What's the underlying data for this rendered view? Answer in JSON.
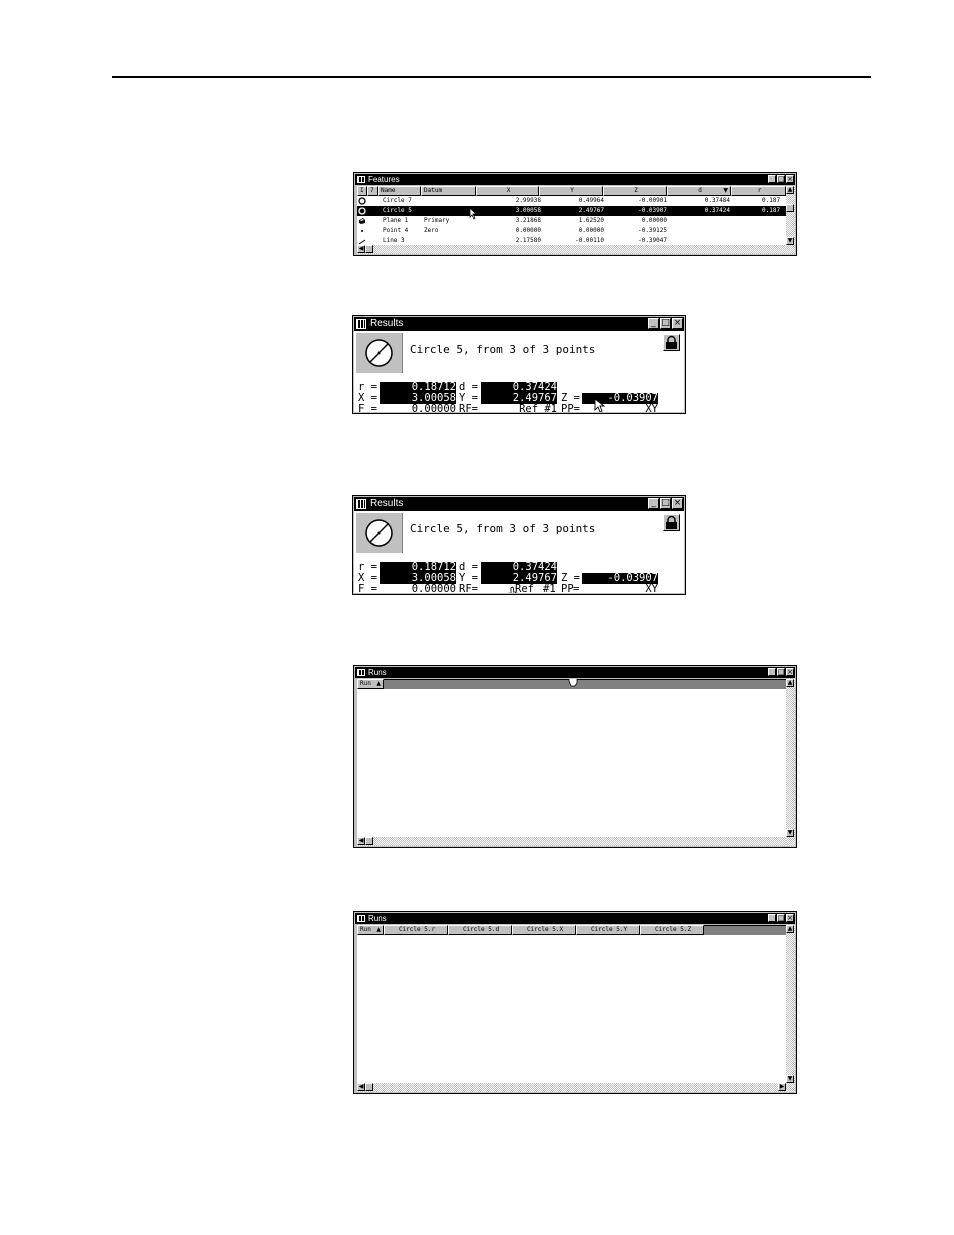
{
  "features": {
    "title": "Features",
    "headers": [
      "I",
      "7",
      "Name",
      "Datum",
      "X",
      "Y",
      "Z",
      "d",
      "r"
    ],
    "rows": [
      {
        "icon": "circle-icon",
        "name": "Circle 7",
        "datum": "",
        "x": "2.99938",
        "y": "0.49964",
        "z": "-0.00901",
        "d": "0.37484",
        "r": "0.187",
        "selected": false
      },
      {
        "icon": "circle-icon",
        "name": "Circle 5",
        "datum": "",
        "x": "3.00058",
        "y": "2.49767",
        "z": "-0.03907",
        "d": "0.37424",
        "r": "0.187",
        "selected": true
      },
      {
        "icon": "plane-icon",
        "name": "Plane 1",
        "datum": "Primary",
        "x": "3.21868",
        "y": "1.62520",
        "z": "0.00000",
        "d": "",
        "r": "",
        "selected": false
      },
      {
        "icon": "point-icon",
        "name": "Point 4",
        "datum": "Zero",
        "x": "0.00000",
        "y": "0.00000",
        "z": "-0.39125",
        "d": "",
        "r": "",
        "selected": false
      },
      {
        "icon": "line-icon",
        "name": "Line 3",
        "datum": "",
        "x": "2.17580",
        "y": "-0.00110",
        "z": "-0.39047",
        "d": "",
        "r": "",
        "selected": false
      }
    ]
  },
  "results1": {
    "title": "Results",
    "heading": "Circle 5, from 3 of 3 points",
    "r_label": "r =",
    "r_value": "0.18712",
    "d_label": "d =",
    "d_value": "0.37424",
    "x_label": "X =",
    "x_value": "3.00058",
    "y_label": "Y =",
    "y_value": "2.49767",
    "z_label": "Z =",
    "z_value": "-0.03907",
    "f_label": "F =",
    "f_value": "0.00000",
    "rf_label": "RF=",
    "rf_value": "Ref #1",
    "pp_label": "PP=",
    "pp_value": "XY"
  },
  "results2": {
    "title": "Results",
    "heading": "Circle 5, from 3 of 3 points",
    "r_label": "r =",
    "r_value": "0.18712",
    "d_label": "d =",
    "d_value": "0.37424",
    "x_label": "X =",
    "x_value": "3.00058",
    "y_label": "Y =",
    "y_value": "2.49767",
    "z_label": "Z =",
    "z_value": "-0.03907",
    "f_label": "F =",
    "f_value": "0.00000",
    "rf_label": "RF=",
    "rf_ref": "Ref",
    "rf_num": "#1",
    "pp_label": "PP",
    "pp_eq": "=",
    "pp_value": "XY"
  },
  "runs1": {
    "title": "Runs",
    "headers": [
      "Run"
    ]
  },
  "runs2": {
    "title": "Runs",
    "headers": [
      "Run",
      "Circle 5.r",
      "Circle 5.d",
      "Circle 5.X",
      "Circle 5.Y",
      "Circle 5.Z"
    ]
  }
}
